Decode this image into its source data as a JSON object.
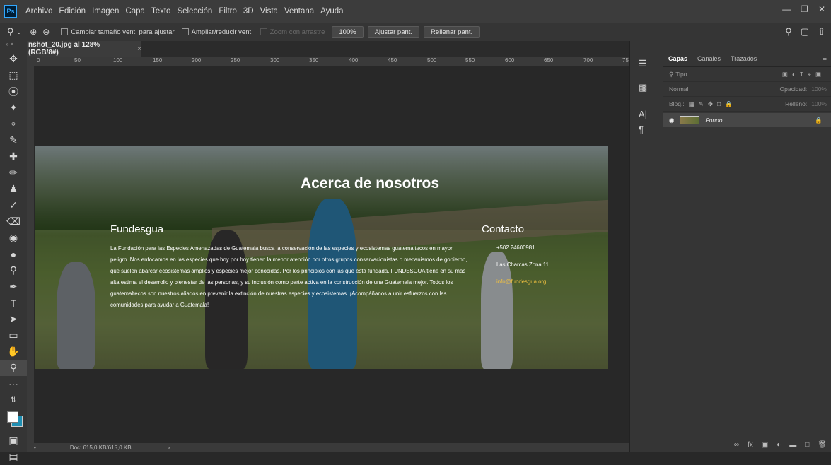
{
  "app": {
    "logo": "Ps"
  },
  "menu": [
    "Archivo",
    "Edición",
    "Imagen",
    "Capa",
    "Texto",
    "Selección",
    "Filtro",
    "3D",
    "Vista",
    "Ventana",
    "Ayuda"
  ],
  "options": {
    "opt1": "Cambiar tamaño vent. para ajustar",
    "opt2": "Ampliar/reducir vent.",
    "opt3": "Zoom con arrastre",
    "zoom": "100%",
    "fit_btn": "Ajustar pant.",
    "fill_btn": "Rellenar pant."
  },
  "document": {
    "tab_title": "nshot_20.jpg al 128% (RGB/8#)",
    "status": "Doc: 615,0 KB/615,0 KB"
  },
  "ruler_ticks": [
    "0",
    "50",
    "100",
    "150",
    "200",
    "250",
    "300",
    "350",
    "400",
    "450",
    "500",
    "550",
    "600",
    "650",
    "700",
    "75"
  ],
  "page_image": {
    "title": "Acerca de nosotros",
    "left_title": "Fundesgua",
    "left_text": "La Fundación para las Especies Amenazadas de Guatemala busca la conservación de las especies y ecosistemas guatemaltecos en mayor peligro. Nos enfocamos en las especies que hoy por hoy tienen la menor atención por otros grupos conservacionistas o mecanismos de gobierno, que suelen abarcar ecosistemas amplios y especies mejor conocidas. Por los principios con las que está fundada, FUNDESGUA tiene en su más alta estima el desarrollo y bienestar de las personas, y su inclusión como parte activa en la construcción de una Guatemala mejor. Todos los guatemaltecos son nuestros aliados en prevenir la extinción de nuestras especies y ecosistemas. ¡Acompáñanos a unir esfuerzos con las comunidades para ayudar a Guatemala!",
    "right_title": "Contacto",
    "contact": [
      "+502 24600981",
      "Las Charcas Zona 11",
      "info@fundesgua.org"
    ]
  },
  "panel": {
    "tabs": [
      "Capas",
      "Canales",
      "Trazados"
    ],
    "search": "Tipo",
    "blend": "Normal",
    "opacity_label": "Opacidad:",
    "opacity": "100%",
    "lock_label": "Bloq.:",
    "fill_label": "Relleno:",
    "fill": "100%",
    "layer_name": "Fondo"
  },
  "colors": {
    "accent": "#31a8ff",
    "bg": "#282828",
    "panel": "#353535"
  }
}
